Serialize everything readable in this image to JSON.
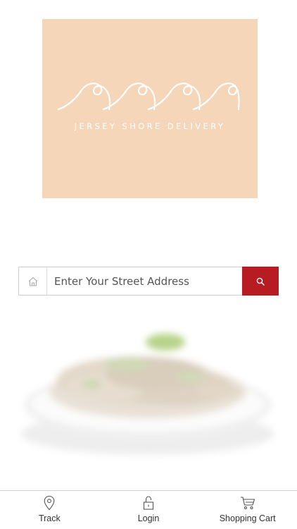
{
  "colors": {
    "logo_background": "#f5d6b8",
    "accent": "#b71c22",
    "nav_text": "#333333"
  },
  "logo": {
    "text": "JERSEY SHORE DELIVERY",
    "icon": "waves-icon"
  },
  "address_search": {
    "placeholder": "Enter Your Street Address",
    "value": "",
    "leading_icon": "home-icon",
    "button_icon": "search-icon"
  },
  "hero": {
    "icon": "food-plate-image"
  },
  "bottom_nav": {
    "items": [
      {
        "label": "Track",
        "icon": "location-pin-icon"
      },
      {
        "label": "Login",
        "icon": "unlock-icon"
      },
      {
        "label": "Shopping Cart",
        "icon": "cart-icon"
      }
    ]
  }
}
